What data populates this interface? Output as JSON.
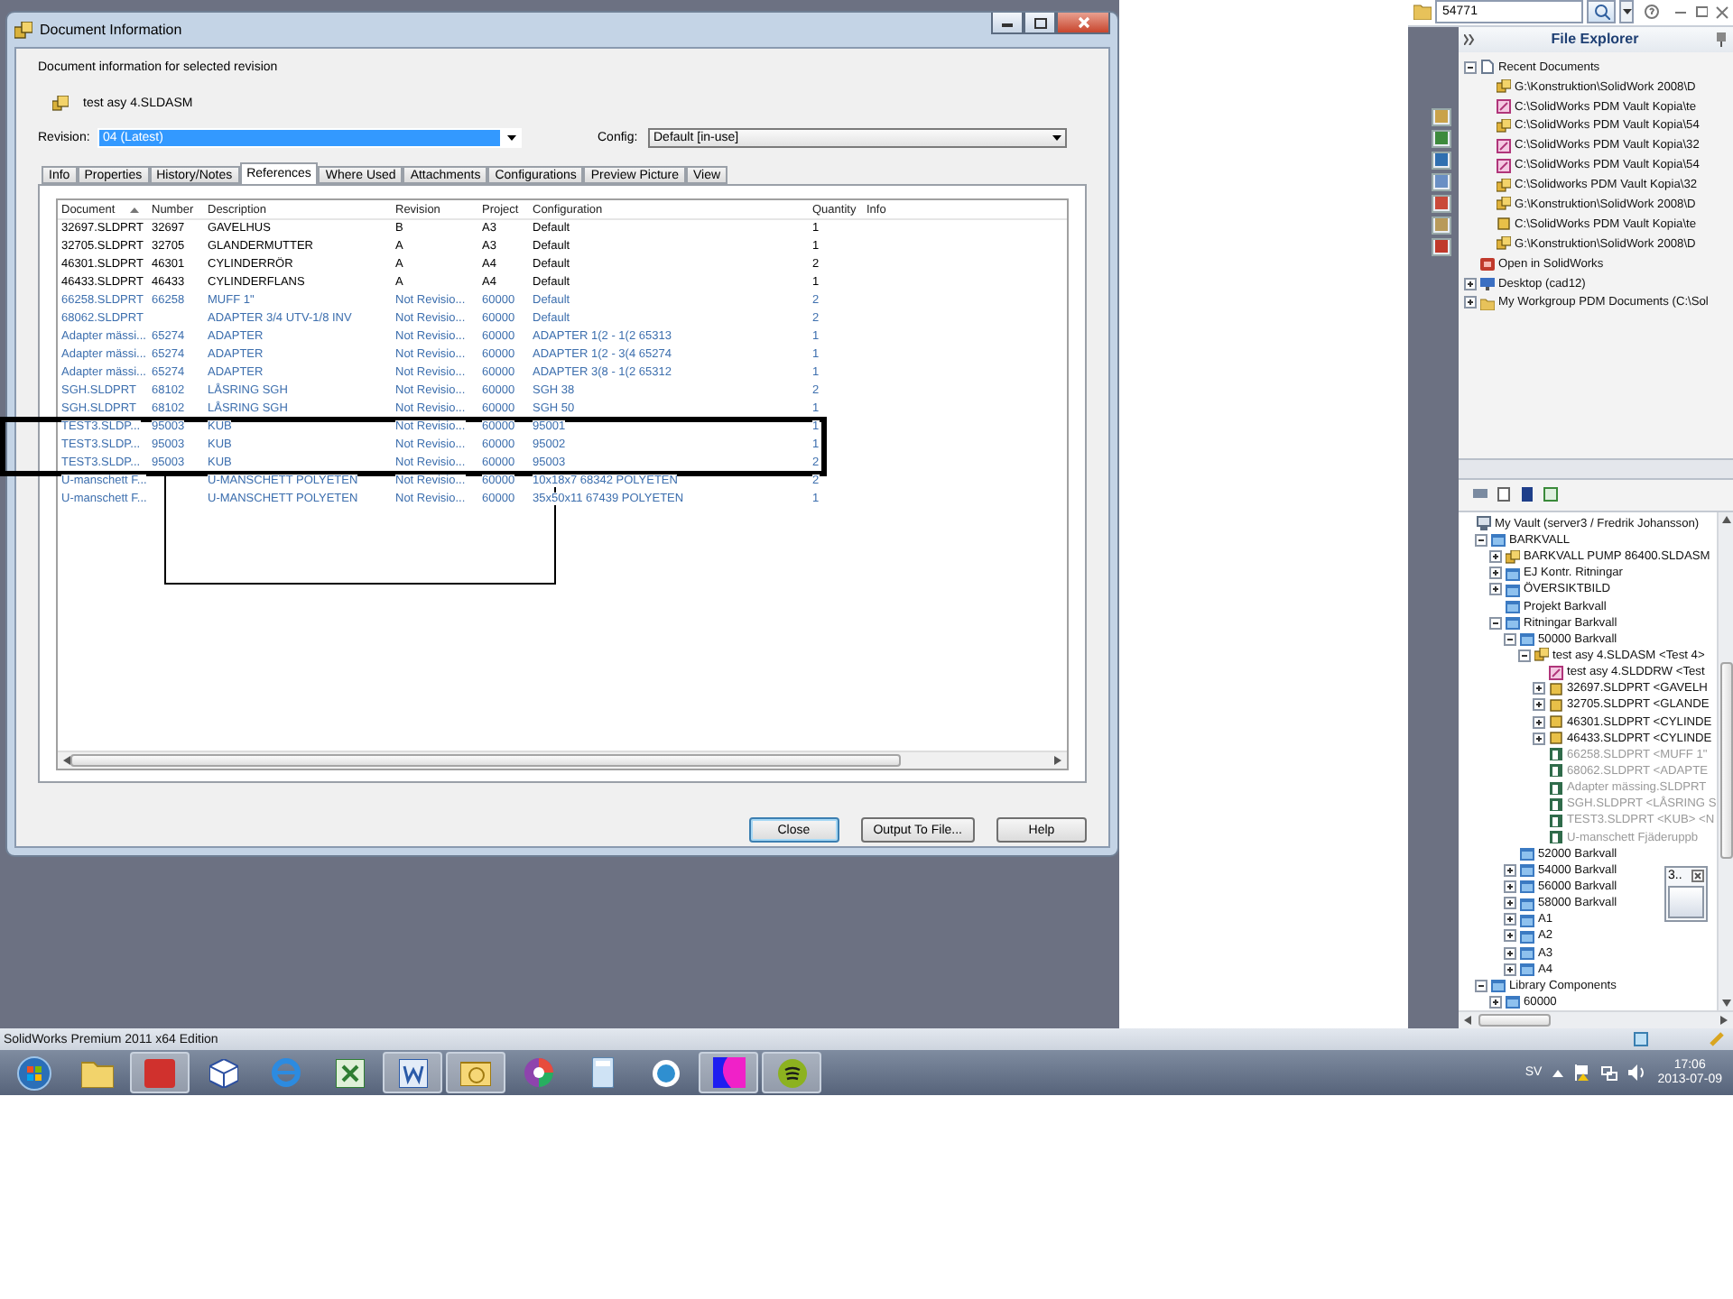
{
  "dialog": {
    "title": "Document Information",
    "subtitle": "Document information for selected revision",
    "document": "test asy 4.SLDASM",
    "revision": {
      "label": "Revision:",
      "value": "04 (Latest)"
    },
    "config": {
      "label": "Config:",
      "value": "Default [in-use]"
    },
    "tabs": [
      {
        "label": "Info",
        "selected": false
      },
      {
        "label": "Properties",
        "selected": false
      },
      {
        "label": "History/Notes",
        "selected": false
      },
      {
        "label": "References",
        "selected": true
      },
      {
        "label": "Where Used",
        "selected": false
      },
      {
        "label": "Attachments",
        "selected": false
      },
      {
        "label": "Configurations",
        "selected": false
      },
      {
        "label": "Preview Picture",
        "selected": false
      },
      {
        "label": "View",
        "selected": false
      }
    ],
    "table": {
      "columns": [
        "Document",
        "Number",
        "Description",
        "Revision",
        "Project",
        "Configuration",
        "Quantity",
        "Info"
      ],
      "rows": [
        {
          "document": "32697.SLDPRT",
          "number": "32697",
          "description": "GAVELHUS",
          "revision": "B",
          "project": "A3",
          "configuration": "Default",
          "quantity": "1",
          "color": "#000000"
        },
        {
          "document": "32705.SLDPRT",
          "number": "32705",
          "description": "GLANDERMUTTER",
          "revision": "A",
          "project": "A3",
          "configuration": "Default",
          "quantity": "1",
          "color": "#000000"
        },
        {
          "document": "46301.SLDPRT",
          "number": "46301",
          "description": "CYLINDERRÖR",
          "revision": "A",
          "project": "A4",
          "configuration": "Default",
          "quantity": "2",
          "color": "#000000"
        },
        {
          "document": "46433.SLDPRT",
          "number": "46433",
          "description": "CYLINDERFLANS",
          "revision": "A",
          "project": "A4",
          "configuration": "Default",
          "quantity": "1",
          "color": "#000000"
        },
        {
          "document": "66258.SLDPRT",
          "number": "66258",
          "description": "MUFF 1\"",
          "revision": "Not Revisio...",
          "project": "60000",
          "configuration": "Default",
          "quantity": "2",
          "color": "#3d6fae"
        },
        {
          "document": "68062.SLDPRT",
          "description": "ADAPTER 3/4 UTV-1/8 INV",
          "revision": "Not Revisio...",
          "project": "60000",
          "configuration": "Default",
          "quantity": "2",
          "color": "#3d6fae"
        },
        {
          "document": "Adapter mässi...",
          "number": "65274",
          "description": "ADAPTER",
          "revision": "Not Revisio...",
          "project": "60000",
          "configuration": "ADAPTER 1(2 - 1(2 65313",
          "quantity": "1",
          "color": "#3d6fae"
        },
        {
          "document": "Adapter mässi...",
          "number": "65274",
          "description": "ADAPTER",
          "revision": "Not Revisio...",
          "project": "60000",
          "configuration": "ADAPTER 1(2 - 3(4 65274",
          "quantity": "1",
          "color": "#3d6fae"
        },
        {
          "document": "Adapter mässi...",
          "number": "65274",
          "description": "ADAPTER",
          "revision": "Not Revisio...",
          "project": "60000",
          "configuration": "ADAPTER 3(8 - 1(2 65312",
          "quantity": "1",
          "color": "#3d6fae"
        },
        {
          "document": "SGH.SLDPRT",
          "number": "68102",
          "description": "LÅSRING SGH",
          "revision": "Not Revisio...",
          "project": "60000",
          "configuration": "SGH 38",
          "quantity": "2",
          "color": "#3d6fae"
        },
        {
          "document": "SGH.SLDPRT",
          "number": "68102",
          "description": "LÅSRING SGH",
          "revision": "Not Revisio...",
          "project": "60000",
          "configuration": "SGH 50",
          "quantity": "1",
          "color": "#3d6fae"
        },
        {
          "document": "TEST3.SLDP...",
          "number": "95003",
          "description": "KUB",
          "revision": "Not Revisio...",
          "project": "60000",
          "configuration": "95001",
          "quantity": "1",
          "color": "#3d6fae"
        },
        {
          "document": "TEST3.SLDP...",
          "number": "95003",
          "description": "KUB",
          "revision": "Not Revisio...",
          "project": "60000",
          "configuration": "95002",
          "quantity": "1",
          "color": "#3d6fae"
        },
        {
          "document": "TEST3.SLDP...",
          "number": "95003",
          "description": "KUB",
          "revision": "Not Revisio...",
          "project": "60000",
          "configuration": "95003",
          "quantity": "2",
          "color": "#3d6fae"
        },
        {
          "document": "U-manschett F...",
          "description": "U-MANSCHETT POLYETEN",
          "revision": "Not Revisio...",
          "project": "60000",
          "configuration": "10x18x7 68342 POLYETEN",
          "quantity": "2",
          "color": "#3d6fae"
        },
        {
          "document": "U-manschett F...",
          "description": "U-MANSCHETT POLYETEN",
          "revision": "Not Revisio...",
          "project": "60000",
          "configuration": "35x50x11 67439 POLYETEN",
          "quantity": "1",
          "color": "#3d6fae"
        }
      ]
    },
    "buttons": [
      {
        "label": "Close",
        "default": true
      },
      {
        "label": "Output To File...",
        "default": false
      },
      {
        "label": "Help",
        "default": false
      }
    ]
  },
  "search": {
    "value": "54771"
  },
  "file_explorer": {
    "title": "File Explorer",
    "tree": [
      {
        "label": "Recent Documents",
        "kind": "recent",
        "expanded": true,
        "children": [
          {
            "label": "G:\\Konstruktion\\SolidWork 2008\\D",
            "kind": "assembly"
          },
          {
            "label": "C:\\SolidWorks PDM Vault Kopia\\te",
            "kind": "drawing"
          },
          {
            "label": "C:\\SolidWorks PDM Vault Kopia\\54",
            "kind": "assembly"
          },
          {
            "label": "C:\\SolidWorks PDM Vault Kopia\\32",
            "kind": "drawing"
          },
          {
            "label": "C:\\SolidWorks PDM Vault Kopia\\54",
            "kind": "drawing"
          },
          {
            "label": "C:\\Solidworks PDM Vault Kopia\\32",
            "kind": "assembly"
          },
          {
            "label": "G:\\Konstruktion\\SolidWork 2008\\D",
            "kind": "assembly"
          },
          {
            "label": "C:\\SolidWorks PDM Vault Kopia\\te",
            "kind": "part"
          },
          {
            "label": "G:\\Konstruktion\\SolidWork 2008\\D",
            "kind": "assembly"
          }
        ]
      },
      {
        "label": "Open in SolidWorks",
        "kind": "open"
      },
      {
        "label": "Desktop (cad12)",
        "kind": "desktop",
        "expanded": false
      },
      {
        "label": "My Workgroup PDM Documents (C:\\Sol",
        "kind": "workgroup",
        "expanded": false
      }
    ]
  },
  "vault_tree": [
    {
      "label": "My Vault (server3 / Fredrik Johansson)",
      "kind": "vault",
      "dimmed": false,
      "children": [
        {
          "label": "BARKVALL",
          "kind": "folder",
          "dimmed": false,
          "expanded": true,
          "children": [
            {
              "label": "BARKVALL PUMP 86400.SLDASM",
              "kind": "assembly",
              "dimmed": false,
              "expanded": false
            },
            {
              "label": "EJ Kontr. Ritningar",
              "kind": "folder",
              "dimmed": false,
              "expanded": false
            },
            {
              "label": "ÖVERSIKTBILD",
              "kind": "folder",
              "dimmed": false,
              "expanded": false
            },
            {
              "label": "Projekt Barkvall",
              "kind": "folder",
              "dimmed": false
            },
            {
              "label": "Ritningar Barkvall",
              "kind": "folder",
              "dimmed": false,
              "expanded": true,
              "children": [
                {
                  "label": "50000 Barkvall",
                  "kind": "folder",
                  "dimmed": false,
                  "expanded": true,
                  "children": [
                    {
                      "label": "test asy 4.SLDASM <Test 4>",
                      "kind": "assembly",
                      "dimmed": false,
                      "expanded": true,
                      "children": [
                        {
                          "label": "test asy 4.SLDDRW <Test",
                          "kind": "drawing",
                          "dimmed": false
                        },
                        {
                          "label": "32697.SLDPRT <GAVELH",
                          "kind": "part",
                          "dimmed": false,
                          "expanded": false
                        },
                        {
                          "label": "32705.SLDPRT <GLANDE",
                          "kind": "part",
                          "dimmed": false,
                          "expanded": false
                        },
                        {
                          "label": "46301.SLDPRT <CYLINDE",
                          "kind": "part",
                          "dimmed": false,
                          "expanded": false
                        },
                        {
                          "label": "46433.SLDPRT <CYLINDE",
                          "kind": "part",
                          "dimmed": false,
                          "expanded": false
                        },
                        {
                          "label": "66258.SLDPRT <MUFF 1\"",
                          "kind": "library",
                          "dimmed": true
                        },
                        {
                          "label": "68062.SLDPRT <ADAPTE",
                          "kind": "library",
                          "dimmed": true
                        },
                        {
                          "label": "Adapter mässing.SLDPRT",
                          "kind": "library",
                          "dimmed": true
                        },
                        {
                          "label": "SGH.SLDPRT <LÅSRING S",
                          "kind": "library",
                          "dimmed": true
                        },
                        {
                          "label": "TEST3.SLDPRT <KUB> <N",
                          "kind": "library",
                          "dimmed": true
                        },
                        {
                          "label": "U-manschett Fjäderuppb",
                          "kind": "library",
                          "dimmed": true
                        }
                      ]
                    }
                  ]
                },
                {
                  "label": "52000 Barkvall",
                  "kind": "folder",
                  "dimmed": false
                },
                {
                  "label": "54000 Barkvall",
                  "kind": "folder",
                  "dimmed": false,
                  "expanded": false
                },
                {
                  "label": "56000 Barkvall",
                  "kind": "folder",
                  "dimmed": false,
                  "expanded": false
                },
                {
                  "label": "58000 Barkvall",
                  "kind": "folder",
                  "dimmed": false,
                  "expanded": false
                },
                {
                  "label": "A1",
                  "kind": "folder",
                  "dimmed": false,
                  "expanded": false
                },
                {
                  "label": "A2",
                  "kind": "folder",
                  "dimmed": false,
                  "expanded": false
                },
                {
                  "label": "A3",
                  "kind": "folder",
                  "dimmed": false,
                  "expanded": false
                },
                {
                  "label": "A4",
                  "kind": "folder",
                  "dimmed": false,
                  "expanded": false
                }
              ]
            }
          ]
        },
        {
          "label": "Library Components",
          "kind": "folder",
          "dimmed": false,
          "expanded": true,
          "children": [
            {
              "label": "60000",
              "kind": "folder",
              "dimmed": false,
              "expanded": false
            }
          ]
        }
      ]
    }
  ],
  "preview_popup": {
    "label": "3.."
  },
  "status_bar": {
    "text": "SolidWorks Premium 2011 x64 Edition"
  },
  "taskbar": {
    "language": "SV",
    "time": "17:06",
    "date": "2013-07-09"
  }
}
